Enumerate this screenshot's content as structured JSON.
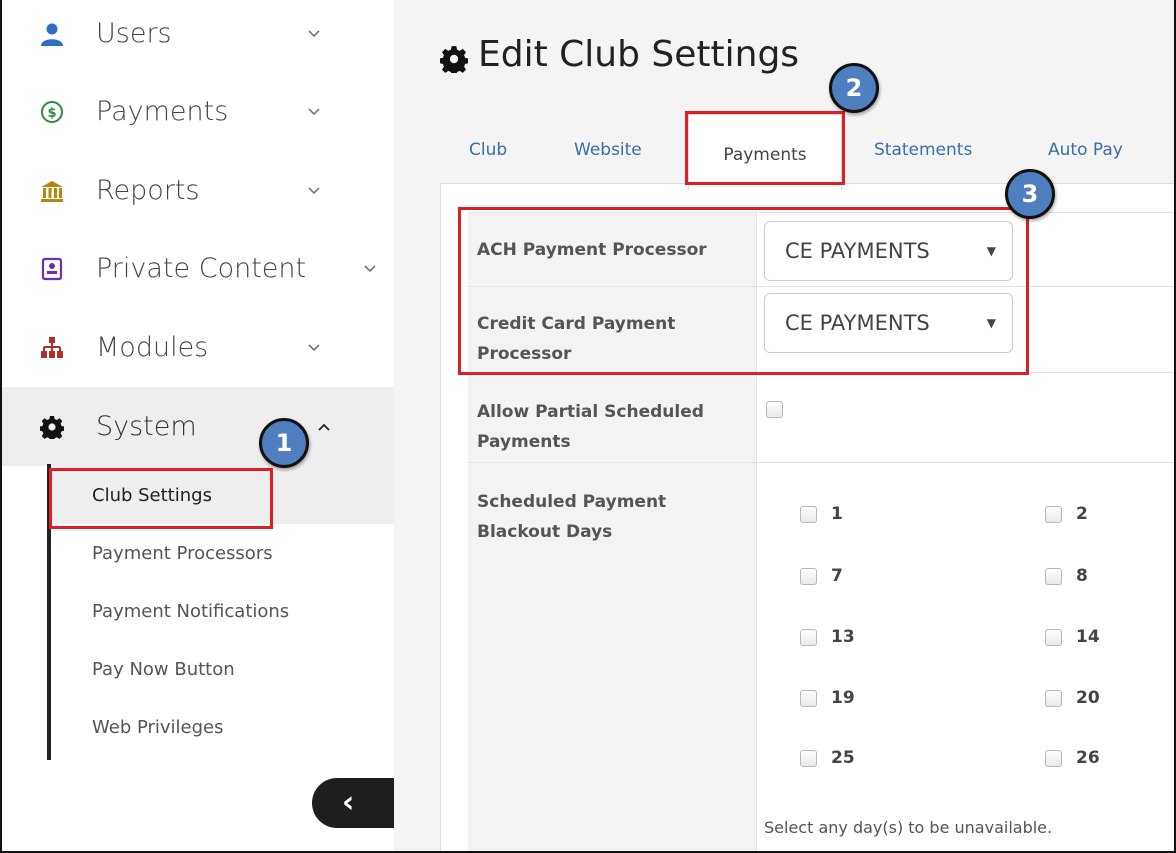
{
  "sidebar": {
    "items": [
      {
        "label": "Users",
        "icon": "user-icon"
      },
      {
        "label": "Payments",
        "icon": "dollar-circle-icon"
      },
      {
        "label": "Reports",
        "icon": "bank-icon"
      },
      {
        "label": "Private Content",
        "icon": "id-card-icon"
      },
      {
        "label": "Modules",
        "icon": "sitemap-icon"
      },
      {
        "label": "System",
        "icon": "gear-icon"
      }
    ],
    "submenu": [
      {
        "label": "Club Settings"
      },
      {
        "label": "Payment Processors"
      },
      {
        "label": "Payment Notifications"
      },
      {
        "label": "Pay Now Button"
      },
      {
        "label": "Web Privileges"
      }
    ],
    "collapse_glyph": "‹"
  },
  "header": {
    "title": "Edit Club Settings"
  },
  "tabs": [
    {
      "label": "Club"
    },
    {
      "label": "Website"
    },
    {
      "label": "Payments"
    },
    {
      "label": "Statements"
    },
    {
      "label": "Auto Pay"
    }
  ],
  "settings": {
    "ach_label": "ACH Payment Processor",
    "ach_value": "CE PAYMENTS",
    "cc_label_line1": "Credit Card Payment",
    "cc_label_line2": "Processor",
    "cc_value": "CE PAYMENTS",
    "partial_label_line1": "Allow Partial Scheduled",
    "partial_label_line2": "Payments",
    "blackout_label_line1": "Scheduled Payment",
    "blackout_label_line2": "Blackout Days",
    "blackout_days": [
      "1",
      "2",
      "7",
      "8",
      "13",
      "14",
      "19",
      "20",
      "25",
      "26"
    ],
    "blackout_help": "Select any day(s) to be unavailable."
  },
  "annotations": [
    "1",
    "2",
    "3"
  ],
  "colors": {
    "accent_red": "#e01e26",
    "marker_blue": "#4f7fbe",
    "link_blue": "#3a6ea8",
    "user_icon": "#2e6dbf",
    "payments_icon": "#2e8b3d",
    "reports_icon": "#b8860b",
    "private_icon": "#6a2fb0",
    "modules_icon": "#b03030"
  }
}
